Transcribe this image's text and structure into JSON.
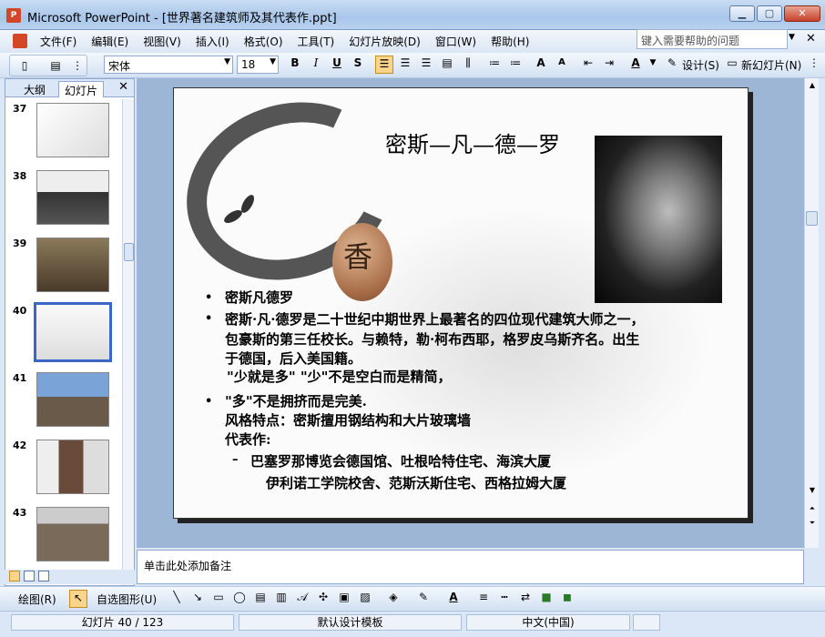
{
  "window": {
    "app_icon_text": "P",
    "title": "Microsoft PowerPoint - [世界著名建筑师及其代表作.ppt]",
    "minimize": "▁",
    "maximize": "▢",
    "close": "✕"
  },
  "menu": {
    "items": [
      "文件(F)",
      "编辑(E)",
      "视图(V)",
      "插入(I)",
      "格式(O)",
      "工具(T)",
      "幻灯片放映(D)",
      "窗口(W)",
      "帮助(H)"
    ],
    "help_placeholder": "键入需要帮助的问题",
    "help_arrow": "▼",
    "doc_close": "✕"
  },
  "toolbar": {
    "font_name": "宋体",
    "font_size": "18",
    "bold": "B",
    "italic": "I",
    "underline": "U",
    "shadow": "S",
    "design_label": "设计(S)",
    "new_slide_label": "新幻灯片(N)"
  },
  "left_panel": {
    "tab_outline": "大纲",
    "tab_slides": "幻灯片",
    "close": "✕",
    "thumbnails": [
      {
        "num": "37",
        "selected": false
      },
      {
        "num": "38",
        "selected": false
      },
      {
        "num": "39",
        "selected": false
      },
      {
        "num": "40",
        "selected": true
      },
      {
        "num": "41",
        "selected": false
      },
      {
        "num": "42",
        "selected": false
      },
      {
        "num": "43",
        "selected": false
      }
    ]
  },
  "slide": {
    "title": "密斯—凡—德—罗",
    "stone_char": "香",
    "lines": [
      "密斯凡德罗",
      "  密斯·凡·德罗是二十世纪中期世界上最著名的四位现代建筑大师之一，",
      "包豪斯的第三任校长。与赖特，勒·柯布西耶，格罗皮乌斯齐名。出生",
      "于德国，后入美国籍。",
      "\"少就是多\" \"少\"不是空白而是精简，",
      "\"多\"不是拥挤而是完美.",
      " 风格特点：密斯擅用钢结构和大片玻璃墙",
      "代表作:",
      "巴塞罗那博览会德国馆、吐根哈特住宅、海滨大厦",
      "伊利诺工学院校舍、范斯沃斯住宅、西格拉姆大厦"
    ],
    "bullet": "•",
    "dash": "–"
  },
  "notes": {
    "placeholder": "单击此处添加备注"
  },
  "drawbar": {
    "draw_label": "绘图(R)",
    "autoshape_label": "自选图形(U)"
  },
  "status": {
    "slide_pos": "幻灯片 40 / 123",
    "template": "默认设计模板",
    "language": "中文(中国)"
  },
  "colors": {
    "accent": "#3b67c4",
    "titlebar": "#a9c6ea",
    "canvas_bg": "#9eb6d6"
  }
}
